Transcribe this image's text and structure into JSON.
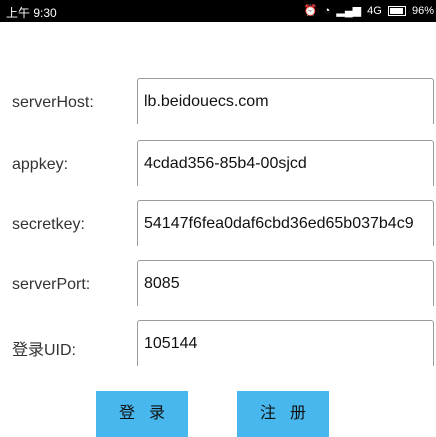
{
  "status_bar": {
    "time": "上午 9:30",
    "alarm_icon": "alarm-clock-icon",
    "wifi_icon": "wifi-icon",
    "signal_text": "4G",
    "battery_text": "96%"
  },
  "form": {
    "fields": [
      {
        "label": "serverHost:",
        "value": "lb.beidouecs.com"
      },
      {
        "label": "appkey:",
        "value": "4cdad356-85b4-00sjcd"
      },
      {
        "label": "secretkey:",
        "value": "54147f6fea0daf6cbd36ed65b037b4c9"
      },
      {
        "label": "serverPort:",
        "value": "8085"
      },
      {
        "label": "登录UID:",
        "value": "105144"
      }
    ]
  },
  "buttons": {
    "login": "登录",
    "register": "注册"
  },
  "colors": {
    "button_bg": "#47b7ee",
    "status_bar_bg": "#000000"
  }
}
